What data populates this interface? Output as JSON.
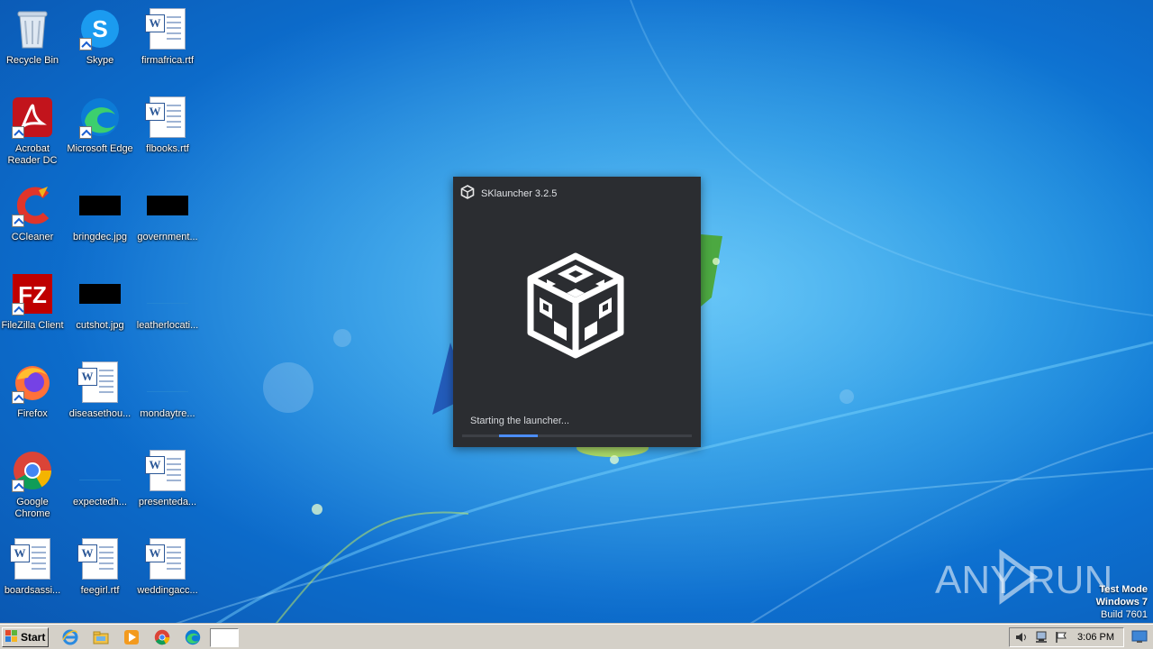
{
  "desktop": {
    "icons": [
      {
        "label": "Recycle Bin",
        "icon": "recycle-bin-icon"
      },
      {
        "label": "Skype",
        "icon": "skype-icon"
      },
      {
        "label": "firmafrica.rtf",
        "icon": "word-document-icon"
      },
      {
        "label": "Acrobat Reader DC",
        "icon": "acrobat-reader-icon"
      },
      {
        "label": "Microsoft Edge",
        "icon": "edge-icon"
      },
      {
        "label": "flbooks.rtf",
        "icon": "word-document-icon"
      },
      {
        "label": "CCleaner",
        "icon": "ccleaner-icon"
      },
      {
        "label": "bringdec.jpg",
        "icon": "image-file-icon"
      },
      {
        "label": "government...",
        "icon": "image-file-icon"
      },
      {
        "label": "FileZilla Client",
        "icon": "filezilla-icon"
      },
      {
        "label": "cutshot.jpg",
        "icon": "image-file-icon"
      },
      {
        "label": "leatherlocati...",
        "icon": "file-icon"
      },
      {
        "label": "Firefox",
        "icon": "firefox-icon"
      },
      {
        "label": "diseasethou...",
        "icon": "word-document-icon"
      },
      {
        "label": "mondaytre...",
        "icon": "file-icon"
      },
      {
        "label": "Google Chrome",
        "icon": "chrome-icon"
      },
      {
        "label": "expectedh...",
        "icon": "file-icon"
      },
      {
        "label": "presenteda...",
        "icon": "word-document-icon"
      },
      {
        "label": "boardsassi...",
        "icon": "word-document-icon"
      },
      {
        "label": "feegirl.rtf",
        "icon": "word-document-icon"
      },
      {
        "label": "weddingacc...",
        "icon": "word-document-icon"
      }
    ]
  },
  "splash": {
    "title": "SKlauncher 3.2.5",
    "status": "Starting the launcher...",
    "progress_fraction": 0.17,
    "accent": "#4c8df6",
    "background": "#2b2d31"
  },
  "watermark": {
    "text": "ANY RUN"
  },
  "system": {
    "line1": "Test Mode",
    "line2": "Windows 7",
    "line3": "Build 7601"
  },
  "taskbar": {
    "start_label": "Start",
    "pinned": [
      "internet-explorer-icon",
      "file-explorer-icon",
      "media-player-icon",
      "chrome-icon",
      "edge-icon"
    ],
    "clock": "3:06 PM"
  }
}
